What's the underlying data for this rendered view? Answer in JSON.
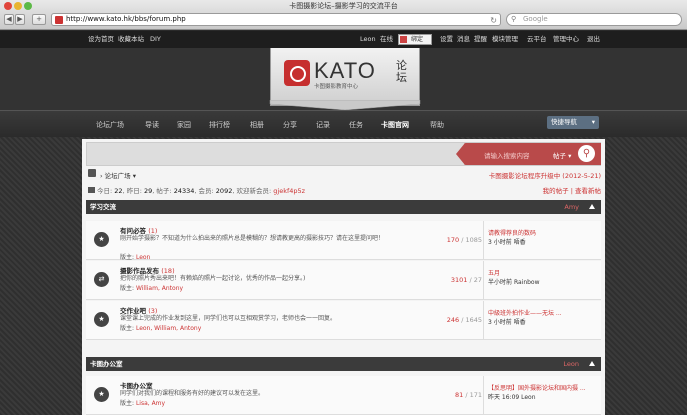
{
  "browser": {
    "window_title": "卡图摄影论坛–摄影学习的交流平台",
    "url": "http://www.kato.hk/bbs/forum.php",
    "search_placeholder": "Google"
  },
  "topbar": {
    "set_home": "设为首页",
    "bookmark": "收藏本站",
    "diy": "DIY",
    "user": "Leon",
    "online": "在线",
    "checkin": "绑定",
    "menu": [
      "设置",
      "消息",
      "提醒",
      "模块管理",
      "云平台",
      "管理中心",
      "退出"
    ]
  },
  "logo": {
    "brand": "KATO",
    "sub": "卡图摄影教育中心",
    "cn": "论坛"
  },
  "mainnav": {
    "items": [
      "论坛广场",
      "导读",
      "家园",
      "排行榜",
      "相册",
      "分享",
      "记录",
      "任务",
      "卡图官网",
      "帮助"
    ],
    "quick": "快捷导航"
  },
  "search": {
    "placeholder": "请输入搜索内容",
    "select": "帖子"
  },
  "breadcrumb": {
    "label": "论坛广场",
    "notice": "卡图摄影论坛程序升级中 (2012-5-21)"
  },
  "stats": {
    "today_label": "今日:",
    "today": "22",
    "yesterday_label": "昨日:",
    "yesterday": "29",
    "posts_label": "帖子:",
    "posts": "24334",
    "members_label": "会员:",
    "members": "2092",
    "welcome_label": "欢迎新会员:",
    "new_member": "gjekf4p5z",
    "my_posts": "我的帖子",
    "view_new": "查看新帖"
  },
  "categories": [
    {
      "title": "学习交流",
      "moderator": "Amy",
      "forums": [
        {
          "name": "有问必答",
          "count": "(1)",
          "desc": "刚开始学摄影？不知道为什么拍出来的照片总是模糊的？想请教更高的摄影技巧？请在这里提问吧！",
          "mods_label": "版主:",
          "mods": "Leon",
          "counts": "170",
          "total": "/ 1085",
          "last_title": "请教得荐良的数码",
          "last_time": "3 小时前",
          "last_user": "唔香",
          "icon": "star"
        },
        {
          "name": "摄影作品发布",
          "count": "(18)",
          "desc": "把你的照片秀出来吧！有赖焰的照片一起讨论，优秀的作品一起分享。)",
          "mods_label": "版主:",
          "mods": "William, Antony",
          "counts": "3101",
          "total": "/ 27",
          "last_title": "五月",
          "last_time": "半小时前",
          "last_user": "Rainbow",
          "icon": "arrows"
        },
        {
          "name": "交作业吧",
          "count": "(3)",
          "desc": "课堂课上完成的作业发到这里，同学们也可以互相观赏学习，老师也会一一回复。",
          "mods_label": "版主:",
          "mods": "Leon, William, Antony",
          "counts": "246",
          "total": "/ 1645",
          "last_title": "中級班外拍作业——无坛 ...",
          "last_time": "3 小时前",
          "last_user": "唔香",
          "icon": "star"
        }
      ]
    },
    {
      "title": "卡图办公室",
      "moderator": "Leon",
      "forums": [
        {
          "name": "卡图办公室",
          "count": "",
          "desc": "同学们对我们的课程和服务有好的建议可以发在这里。",
          "mods_label": "版主:",
          "mods": "Lisa, Amy",
          "counts": "81",
          "total": "/ 171",
          "last_title": "【反思明】国外摄影论坛和国内摄 ...",
          "last_time": "昨天 16:09",
          "last_user": "Leon",
          "icon": "star"
        }
      ]
    }
  ]
}
